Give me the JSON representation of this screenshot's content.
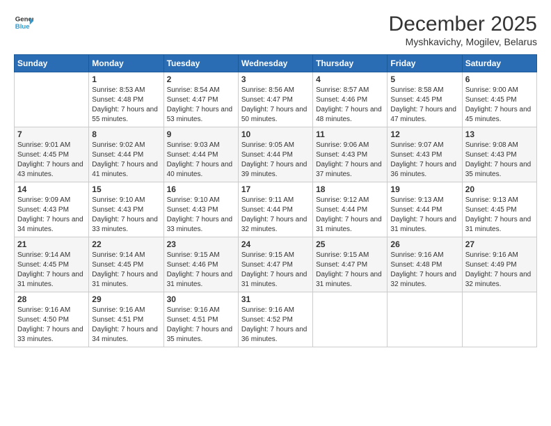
{
  "header": {
    "logo_line1": "General",
    "logo_line2": "Blue",
    "month": "December 2025",
    "location": "Myshkavichy, Mogilev, Belarus"
  },
  "weekdays": [
    "Sunday",
    "Monday",
    "Tuesday",
    "Wednesday",
    "Thursday",
    "Friday",
    "Saturday"
  ],
  "weeks": [
    [
      {
        "day": "",
        "sunrise": "",
        "sunset": "",
        "daylight": ""
      },
      {
        "day": "1",
        "sunrise": "Sunrise: 8:53 AM",
        "sunset": "Sunset: 4:48 PM",
        "daylight": "Daylight: 7 hours and 55 minutes."
      },
      {
        "day": "2",
        "sunrise": "Sunrise: 8:54 AM",
        "sunset": "Sunset: 4:47 PM",
        "daylight": "Daylight: 7 hours and 53 minutes."
      },
      {
        "day": "3",
        "sunrise": "Sunrise: 8:56 AM",
        "sunset": "Sunset: 4:47 PM",
        "daylight": "Daylight: 7 hours and 50 minutes."
      },
      {
        "day": "4",
        "sunrise": "Sunrise: 8:57 AM",
        "sunset": "Sunset: 4:46 PM",
        "daylight": "Daylight: 7 hours and 48 minutes."
      },
      {
        "day": "5",
        "sunrise": "Sunrise: 8:58 AM",
        "sunset": "Sunset: 4:45 PM",
        "daylight": "Daylight: 7 hours and 47 minutes."
      },
      {
        "day": "6",
        "sunrise": "Sunrise: 9:00 AM",
        "sunset": "Sunset: 4:45 PM",
        "daylight": "Daylight: 7 hours and 45 minutes."
      }
    ],
    [
      {
        "day": "7",
        "sunrise": "Sunrise: 9:01 AM",
        "sunset": "Sunset: 4:45 PM",
        "daylight": "Daylight: 7 hours and 43 minutes."
      },
      {
        "day": "8",
        "sunrise": "Sunrise: 9:02 AM",
        "sunset": "Sunset: 4:44 PM",
        "daylight": "Daylight: 7 hours and 41 minutes."
      },
      {
        "day": "9",
        "sunrise": "Sunrise: 9:03 AM",
        "sunset": "Sunset: 4:44 PM",
        "daylight": "Daylight: 7 hours and 40 minutes."
      },
      {
        "day": "10",
        "sunrise": "Sunrise: 9:05 AM",
        "sunset": "Sunset: 4:44 PM",
        "daylight": "Daylight: 7 hours and 39 minutes."
      },
      {
        "day": "11",
        "sunrise": "Sunrise: 9:06 AM",
        "sunset": "Sunset: 4:43 PM",
        "daylight": "Daylight: 7 hours and 37 minutes."
      },
      {
        "day": "12",
        "sunrise": "Sunrise: 9:07 AM",
        "sunset": "Sunset: 4:43 PM",
        "daylight": "Daylight: 7 hours and 36 minutes."
      },
      {
        "day": "13",
        "sunrise": "Sunrise: 9:08 AM",
        "sunset": "Sunset: 4:43 PM",
        "daylight": "Daylight: 7 hours and 35 minutes."
      }
    ],
    [
      {
        "day": "14",
        "sunrise": "Sunrise: 9:09 AM",
        "sunset": "Sunset: 4:43 PM",
        "daylight": "Daylight: 7 hours and 34 minutes."
      },
      {
        "day": "15",
        "sunrise": "Sunrise: 9:10 AM",
        "sunset": "Sunset: 4:43 PM",
        "daylight": "Daylight: 7 hours and 33 minutes."
      },
      {
        "day": "16",
        "sunrise": "Sunrise: 9:10 AM",
        "sunset": "Sunset: 4:43 PM",
        "daylight": "Daylight: 7 hours and 33 minutes."
      },
      {
        "day": "17",
        "sunrise": "Sunrise: 9:11 AM",
        "sunset": "Sunset: 4:44 PM",
        "daylight": "Daylight: 7 hours and 32 minutes."
      },
      {
        "day": "18",
        "sunrise": "Sunrise: 9:12 AM",
        "sunset": "Sunset: 4:44 PM",
        "daylight": "Daylight: 7 hours and 31 minutes."
      },
      {
        "day": "19",
        "sunrise": "Sunrise: 9:13 AM",
        "sunset": "Sunset: 4:44 PM",
        "daylight": "Daylight: 7 hours and 31 minutes."
      },
      {
        "day": "20",
        "sunrise": "Sunrise: 9:13 AM",
        "sunset": "Sunset: 4:45 PM",
        "daylight": "Daylight: 7 hours and 31 minutes."
      }
    ],
    [
      {
        "day": "21",
        "sunrise": "Sunrise: 9:14 AM",
        "sunset": "Sunset: 4:45 PM",
        "daylight": "Daylight: 7 hours and 31 minutes."
      },
      {
        "day": "22",
        "sunrise": "Sunrise: 9:14 AM",
        "sunset": "Sunset: 4:45 PM",
        "daylight": "Daylight: 7 hours and 31 minutes."
      },
      {
        "day": "23",
        "sunrise": "Sunrise: 9:15 AM",
        "sunset": "Sunset: 4:46 PM",
        "daylight": "Daylight: 7 hours and 31 minutes."
      },
      {
        "day": "24",
        "sunrise": "Sunrise: 9:15 AM",
        "sunset": "Sunset: 4:47 PM",
        "daylight": "Daylight: 7 hours and 31 minutes."
      },
      {
        "day": "25",
        "sunrise": "Sunrise: 9:15 AM",
        "sunset": "Sunset: 4:47 PM",
        "daylight": "Daylight: 7 hours and 31 minutes."
      },
      {
        "day": "26",
        "sunrise": "Sunrise: 9:16 AM",
        "sunset": "Sunset: 4:48 PM",
        "daylight": "Daylight: 7 hours and 32 minutes."
      },
      {
        "day": "27",
        "sunrise": "Sunrise: 9:16 AM",
        "sunset": "Sunset: 4:49 PM",
        "daylight": "Daylight: 7 hours and 32 minutes."
      }
    ],
    [
      {
        "day": "28",
        "sunrise": "Sunrise: 9:16 AM",
        "sunset": "Sunset: 4:50 PM",
        "daylight": "Daylight: 7 hours and 33 minutes."
      },
      {
        "day": "29",
        "sunrise": "Sunrise: 9:16 AM",
        "sunset": "Sunset: 4:51 PM",
        "daylight": "Daylight: 7 hours and 34 minutes."
      },
      {
        "day": "30",
        "sunrise": "Sunrise: 9:16 AM",
        "sunset": "Sunset: 4:51 PM",
        "daylight": "Daylight: 7 hours and 35 minutes."
      },
      {
        "day": "31",
        "sunrise": "Sunrise: 9:16 AM",
        "sunset": "Sunset: 4:52 PM",
        "daylight": "Daylight: 7 hours and 36 minutes."
      },
      {
        "day": "",
        "sunrise": "",
        "sunset": "",
        "daylight": ""
      },
      {
        "day": "",
        "sunrise": "",
        "sunset": "",
        "daylight": ""
      },
      {
        "day": "",
        "sunrise": "",
        "sunset": "",
        "daylight": ""
      }
    ]
  ]
}
